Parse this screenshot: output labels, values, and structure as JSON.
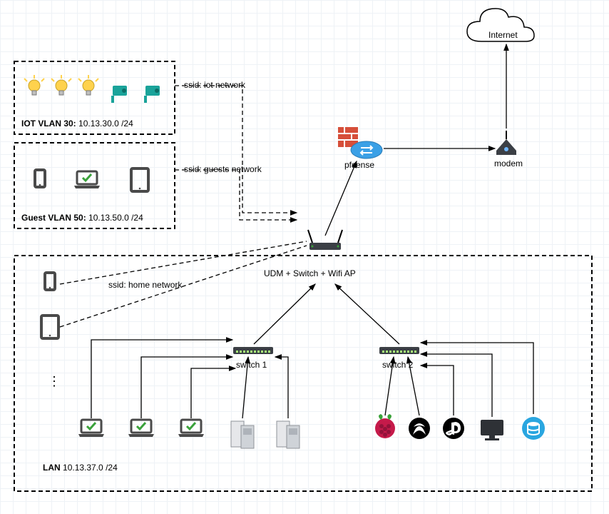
{
  "vlans": {
    "iot": {
      "title": "IOT VLAN 30:",
      "cidr": "10.13.30.0 /24",
      "ssid": "ssid: iot network"
    },
    "guest": {
      "title": "Guest VLAN 50:",
      "cidr": "10.13.50.0 /24",
      "ssid": "ssid: guests network"
    },
    "lan": {
      "title": "LAN",
      "cidr": "10.13.37.0 /24",
      "ssid": "ssid: home network"
    }
  },
  "nodes": {
    "internet": "Internet",
    "modem": "modem",
    "pfsense": "pfsense",
    "udm": "UDM + Switch + Wifi AP",
    "switch1": "switch 1",
    "switch2": "switch 2"
  },
  "icons": {
    "bulb": "bulb",
    "camera": "camera",
    "phone": "phone",
    "laptop": "laptop",
    "tablet": "tablet",
    "server": "server",
    "raspberry": "raspberry",
    "xbox": "xbox",
    "playstation": "playstation",
    "monitor": "monitor",
    "database": "database",
    "ellipsis": "⋮"
  }
}
